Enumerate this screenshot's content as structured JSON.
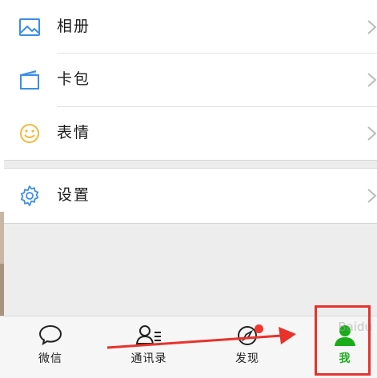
{
  "menu": {
    "items": [
      {
        "label": "相册",
        "icon": "album-icon"
      },
      {
        "label": "卡包",
        "icon": "card-wallet-icon"
      },
      {
        "label": "表情",
        "icon": "sticker-smile-icon"
      },
      {
        "label": "设置",
        "icon": "settings-gear-icon"
      }
    ]
  },
  "tabbar": {
    "tabs": [
      {
        "label": "微信",
        "icon": "chat-bubble-icon"
      },
      {
        "label": "通讯录",
        "icon": "contacts-icon"
      },
      {
        "label": "发现",
        "icon": "discover-compass-icon"
      },
      {
        "label": "我",
        "icon": "me-person-icon",
        "selected": true
      }
    ]
  },
  "watermark": "Baidu",
  "colors": {
    "accent_blue": "#3a8ee6",
    "active_green": "#1aad19",
    "badge_red": "#f43530",
    "annotation_red": "#e8322c"
  }
}
